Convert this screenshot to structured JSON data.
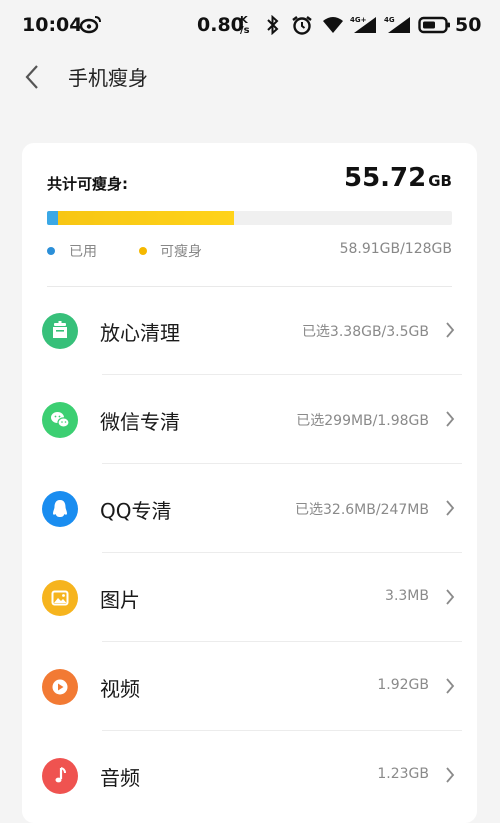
{
  "status_bar": {
    "time": "10:04",
    "net_speed": "0.80",
    "net_speed_unit_top": "K",
    "net_speed_unit_bottom": "/s",
    "signal_1_label": "4G+",
    "signal_2_label": "4G",
    "battery": "50"
  },
  "header": {
    "title": "手机瘦身",
    "back_icon": "chevron-left-icon"
  },
  "summary": {
    "label": "共计可瘦身:",
    "value": "55.72",
    "unit": "GB",
    "used_fraction": 0.027,
    "slimmable_fraction": 0.435,
    "legend_used": "已用",
    "legend_slimmable": "可瘦身",
    "usage_text": "58.91GB/128GB",
    "colors": {
      "used": "#3aa8e6",
      "slimmable": "#f7c614"
    }
  },
  "items": [
    {
      "label": "放心清理",
      "value": "已选3.38GB/3.5GB",
      "icon": "broom-icon",
      "color": "#37c07a"
    },
    {
      "label": "微信专清",
      "value": "已选299MB/1.98GB",
      "icon": "wechat-icon",
      "color": "#3ccf72"
    },
    {
      "label": "QQ专清",
      "value": "已选32.6MB/247MB",
      "icon": "qq-icon",
      "color": "#1a8df0"
    },
    {
      "label": "图片",
      "value": "3.3MB",
      "icon": "image-icon",
      "color": "#f6b41e"
    },
    {
      "label": "视频",
      "value": "1.92GB",
      "icon": "play-icon",
      "color": "#f27a34"
    },
    {
      "label": "音频",
      "value": "1.23GB",
      "icon": "music-icon",
      "color": "#ef5350"
    }
  ]
}
